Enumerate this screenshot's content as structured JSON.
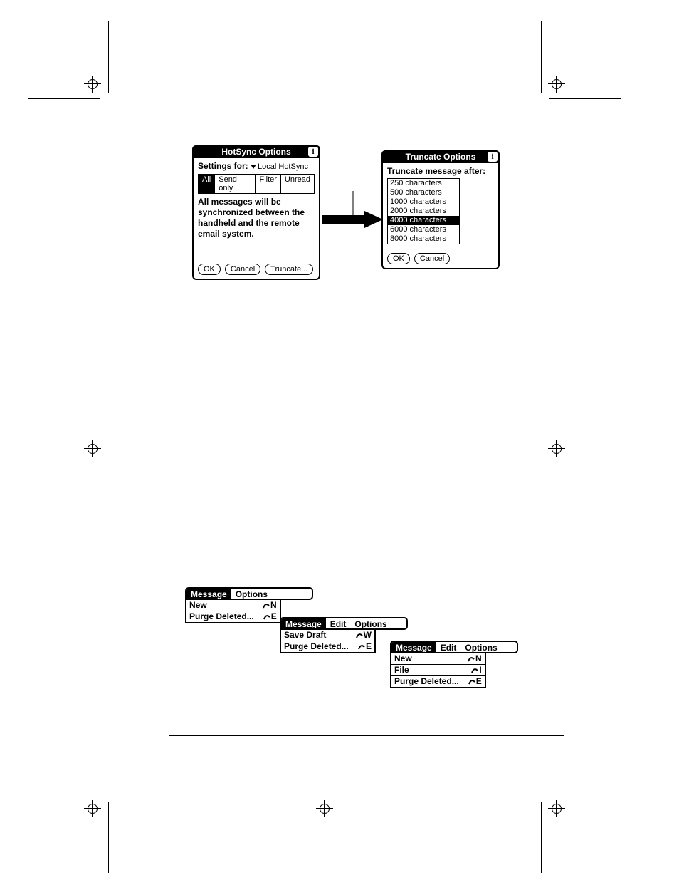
{
  "hotsync": {
    "title": "HotSync Options",
    "settings_label": "Settings for:",
    "dropdown_value": "Local HotSync",
    "tabs": [
      "All",
      "Send only",
      "Filter",
      "Unread"
    ],
    "active_tab_index": 0,
    "description": "All messages will be synchronized between the handheld and the remote email system.",
    "buttons": {
      "ok": "OK",
      "cancel": "Cancel",
      "truncate": "Truncate..."
    }
  },
  "truncate": {
    "title": "Truncate Options",
    "label": "Truncate message after:",
    "options": [
      "250 characters",
      "500 characters",
      "1000 characters",
      "2000 characters",
      "4000 characters",
      "6000 characters",
      "8000 characters"
    ],
    "selected_index": 4,
    "buttons": {
      "ok": "OK",
      "cancel": "Cancel"
    }
  },
  "menus": {
    "m1": {
      "bar": [
        "Message",
        "Options"
      ],
      "active_index": 0,
      "items": [
        {
          "label": "New",
          "shortcut": "N"
        },
        {
          "label": "Purge Deleted...",
          "shortcut": "E"
        }
      ]
    },
    "m2": {
      "bar": [
        "Message",
        "Edit",
        "Options"
      ],
      "active_index": 0,
      "items": [
        {
          "label": "Save Draft",
          "shortcut": "W"
        },
        {
          "label": "Purge Deleted...",
          "shortcut": "E"
        }
      ]
    },
    "m3": {
      "bar": [
        "Message",
        "Edit",
        "Options"
      ],
      "active_index": 0,
      "items": [
        {
          "label": "New",
          "shortcut": "N"
        },
        {
          "label": "File",
          "shortcut": "I"
        },
        {
          "label": "Purge Deleted...",
          "shortcut": "E"
        }
      ]
    }
  }
}
